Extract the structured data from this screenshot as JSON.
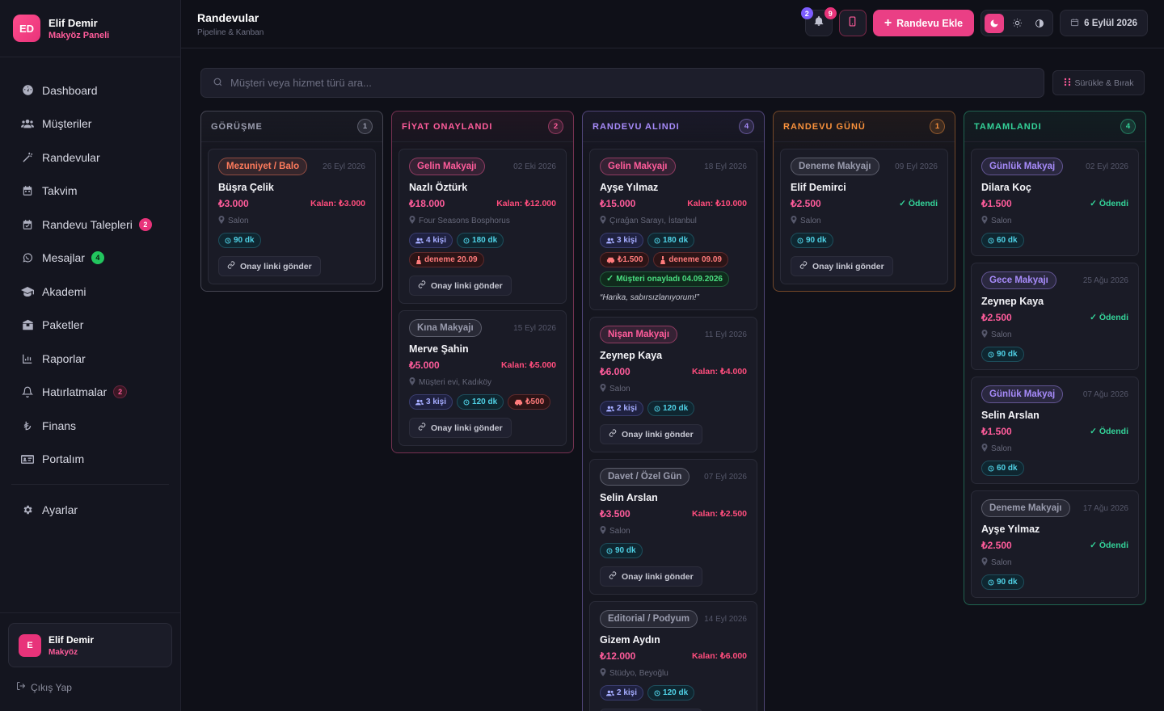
{
  "brand": {
    "initials": "ED",
    "name": "Elif Demir",
    "subtitle": "Makyöz Paneli"
  },
  "nav": [
    {
      "label": "Dashboard",
      "icon": "dashboard-icon"
    },
    {
      "label": "Müşteriler",
      "icon": "users-icon"
    },
    {
      "label": "Randevular",
      "icon": "wand-icon"
    },
    {
      "label": "Takvim",
      "icon": "calendar-icon"
    },
    {
      "label": "Randevu Talepleri",
      "icon": "calendar-check-icon",
      "badge": "2"
    },
    {
      "label": "Mesajlar",
      "icon": "whatsapp-icon",
      "badge": "4"
    },
    {
      "label": "Akademi",
      "icon": "graduation-icon"
    },
    {
      "label": "Paketler",
      "icon": "package-icon"
    },
    {
      "label": "Raporlar",
      "icon": "chart-icon"
    },
    {
      "label": "Hatırlatmalar",
      "icon": "bell-icon",
      "badge": "2"
    },
    {
      "label": "Finans",
      "icon": "lira-icon"
    },
    {
      "label": "Portalım",
      "icon": "id-card-icon"
    },
    {
      "label": "Ayarlar",
      "icon": "gear-icon"
    }
  ],
  "user": {
    "initial": "E",
    "name": "Elif Demir",
    "role": "Makyöz"
  },
  "logout": "Çıkış Yap",
  "header": {
    "title": "Randevular",
    "subtitle": "Pipeline & Kanban",
    "notif_badge": "2",
    "msg_badge": "9",
    "add_label": "Randevu Ekle",
    "date": "6 Eylül 2026"
  },
  "search": {
    "placeholder": "Müşteri veya hizmet türü ara..."
  },
  "drag_label": "Sürükle & Bırak",
  "columns": [
    {
      "title": "GÖRÜŞME",
      "count": "1",
      "color": "#9a9cae",
      "cards": [
        {
          "tag": "Mezuniyet / Balo",
          "tagColor": "#ff7b5c",
          "date": "26 Eyl 2026",
          "name": "Büşra Çelik",
          "price": "₺3.000",
          "kalan": "Kalan: ₺3.000",
          "loc": "Salon",
          "chips": [
            {
              "type": "t",
              "text": "90 dk"
            }
          ],
          "link": "Onay linki gönder"
        }
      ]
    },
    {
      "title": "FİYAT ONAYLANDI",
      "count": "2",
      "color": "#ff5c9b",
      "cards": [
        {
          "tag": "Gelin Makyajı",
          "tagColor": "#ff5c9b",
          "date": "02 Eki 2026",
          "name": "Nazlı Öztürk",
          "price": "₺18.000",
          "kalan": "Kalan: ₺12.000",
          "loc": "Four Seasons Bosphorus",
          "chips": [
            {
              "type": "p",
              "text": "4 kişi"
            },
            {
              "type": "t",
              "text": "180 dk"
            },
            {
              "type": "r",
              "text": "deneme 20.09"
            }
          ],
          "link": "Onay linki gönder"
        },
        {
          "tag": "Kına Makyajı",
          "tagColor": "#9a9cae",
          "date": "15 Eyl 2026",
          "name": "Merve Şahin",
          "price": "₺5.000",
          "kalan": "Kalan: ₺5.000",
          "loc": "Müşteri evi, Kadıköy",
          "chips": [
            {
              "type": "p",
              "text": "3 kişi"
            },
            {
              "type": "t",
              "text": "120 dk"
            },
            {
              "type": "r",
              "text": "₺500"
            }
          ],
          "link": "Onay linki gönder"
        }
      ]
    },
    {
      "title": "RANDEVU ALINDI",
      "count": "4",
      "color": "#a78bfa",
      "cards": [
        {
          "tag": "Gelin Makyajı",
          "tagColor": "#ff5c9b",
          "date": "18 Eyl 2026",
          "name": "Ayşe Yılmaz",
          "price": "₺15.000",
          "kalan": "Kalan: ₺10.000",
          "loc": "Çırağan Sarayı, İstanbul",
          "chips": [
            {
              "type": "p",
              "text": "3 kişi"
            },
            {
              "type": "t",
              "text": "180 dk"
            },
            {
              "type": "r",
              "text": "₺1.500"
            },
            {
              "type": "r",
              "text": "deneme 09.09"
            },
            {
              "type": "g",
              "text": "Müşteri onayladı 04.09.2026"
            }
          ],
          "quote": "“Harika, sabırsızlanıyorum!”"
        },
        {
          "tag": "Nişan Makyajı",
          "tagColor": "#ff5c9b",
          "date": "11 Eyl 2026",
          "name": "Zeynep Kaya",
          "price": "₺6.000",
          "kalan": "Kalan: ₺4.000",
          "loc": "Salon",
          "chips": [
            {
              "type": "p",
              "text": "2 kişi"
            },
            {
              "type": "t",
              "text": "120 dk"
            }
          ],
          "link": "Onay linki gönder"
        },
        {
          "tag": "Davet / Özel Gün",
          "tagColor": "#9a9cae",
          "date": "07 Eyl 2026",
          "name": "Selin Arslan",
          "price": "₺3.500",
          "kalan": "Kalan: ₺2.500",
          "loc": "Salon",
          "chips": [
            {
              "type": "t",
              "text": "90 dk"
            }
          ],
          "link": "Onay linki gönder"
        },
        {
          "tag": "Editorial / Podyum",
          "tagColor": "#9a9cae",
          "date": "14 Eyl 2026",
          "name": "Gizem Aydın",
          "price": "₺12.000",
          "kalan": "Kalan: ₺6.000",
          "loc": "Stüdyo, Beyoğlu",
          "chips": [
            {
              "type": "p",
              "text": "2 kişi"
            },
            {
              "type": "t",
              "text": "120 dk"
            }
          ],
          "link": "Onay linki gönder"
        }
      ]
    },
    {
      "title": "RANDEVU GÜNÜ",
      "count": "1",
      "color": "#fb923c",
      "cards": [
        {
          "tag": "Deneme Makyajı",
          "tagColor": "#9a9cae",
          "date": "09 Eyl 2026",
          "name": "Elif Demirci",
          "price": "₺2.500",
          "paid": "Ödendi",
          "loc": "Salon",
          "chips": [
            {
              "type": "t",
              "text": "90 dk"
            }
          ],
          "link": "Onay linki gönder"
        }
      ]
    },
    {
      "title": "TAMAMLANDI",
      "count": "4",
      "color": "#34d399",
      "cards": [
        {
          "tag": "Günlük Makyaj",
          "tagColor": "#a78bfa",
          "date": "02 Eyl 2026",
          "name": "Dilara Koç",
          "price": "₺1.500",
          "paid": "Ödendi",
          "loc": "Salon",
          "chips": [
            {
              "type": "t",
              "text": "60 dk"
            }
          ]
        },
        {
          "tag": "Gece Makyajı",
          "tagColor": "#a78bfa",
          "date": "25 Ağu 2026",
          "name": "Zeynep Kaya",
          "price": "₺2.500",
          "paid": "Ödendi",
          "loc": "Salon",
          "chips": [
            {
              "type": "t",
              "text": "90 dk"
            }
          ]
        },
        {
          "tag": "Günlük Makyaj",
          "tagColor": "#a78bfa",
          "date": "07 Ağu 2026",
          "name": "Selin Arslan",
          "price": "₺1.500",
          "paid": "Ödendi",
          "loc": "Salon",
          "chips": [
            {
              "type": "t",
              "text": "60 dk"
            }
          ]
        },
        {
          "tag": "Deneme Makyajı",
          "tagColor": "#9a9cae",
          "date": "17 Ağu 2026",
          "name": "Ayşe Yılmaz",
          "price": "₺2.500",
          "paid": "Ödendi",
          "loc": "Salon",
          "chips": [
            {
              "type": "t",
              "text": "90 dk"
            }
          ]
        }
      ]
    }
  ]
}
